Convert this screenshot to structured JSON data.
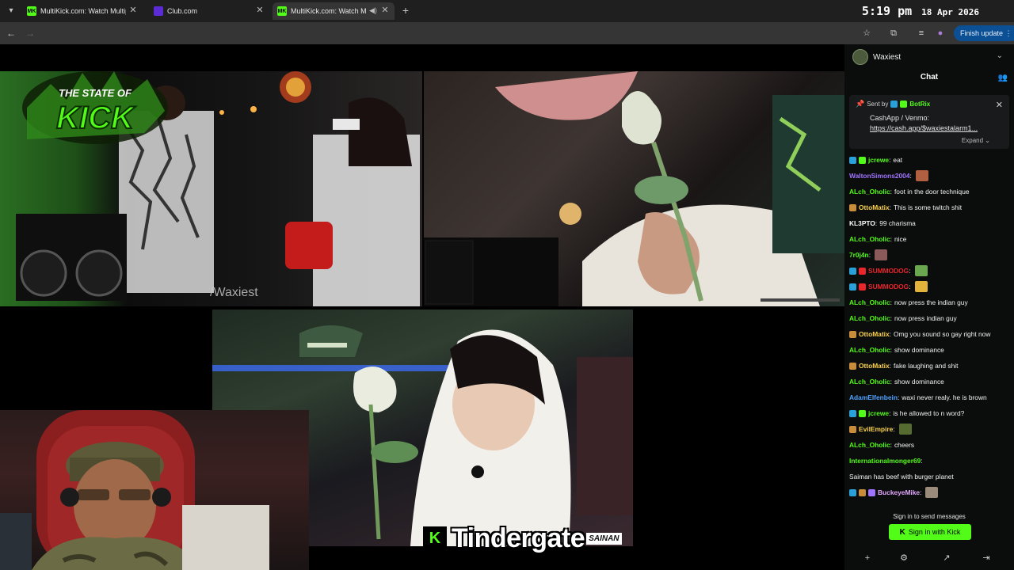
{
  "browser": {
    "tabs": [
      {
        "label": "MultiKick.com: Watch Multiple",
        "favicon": "MK",
        "favicon_color": "#53fc18",
        "active": false
      },
      {
        "label": "Club.com",
        "favicon": "",
        "favicon_color": "#5b2bd6",
        "active": false
      },
      {
        "label": "MultiKick.com: Watch Multi",
        "favicon": "MK",
        "favicon_color": "#53fc18",
        "active": true
      }
    ],
    "clock": {
      "time": "5:19 pm",
      "date": "18 Apr 2026"
    },
    "finish_update_label": "Finish update ⋮",
    "icons": [
      "tab-search-icon",
      "close-icon",
      "speaker-icon",
      "new-tab-icon",
      "back-icon",
      "forward-icon",
      "bookmark-star-icon",
      "extensions-icon",
      "reading-list-icon",
      "profile-icon"
    ]
  },
  "stream": {
    "logo": {
      "line1": "THE STATE OF",
      "line2": "KICK"
    },
    "watermark": "/Waxiest",
    "caption": {
      "text": "Tindergate",
      "tag": "SAINAN"
    }
  },
  "chat": {
    "channel": "Waxiest",
    "title": "Chat",
    "pinned": {
      "sent_by": "Sent by",
      "bot": "BotRix",
      "line1": "CashApp / Venmo:",
      "line2": "https://cash.app/$waxiestalarm1...",
      "expand": "Expand"
    },
    "messages": [
      {
        "user": "jcrewe",
        "color": "#53fc18",
        "text": "eat",
        "badges": [
          "#2aa0d8",
          "#53fc18"
        ],
        "emote": ""
      },
      {
        "user": "WaltonSimons2004",
        "color": "#a074ff",
        "text": "",
        "badges": [],
        "emote": "#b06040"
      },
      {
        "user": "ALch_Oholic",
        "color": "#53fc18",
        "text": "foot in the door technique",
        "badges": [],
        "emote": ""
      },
      {
        "user": "OttoMatix",
        "color": "#fcd34d",
        "text": "This is some twitch shit",
        "badges": [
          "#c98c3a"
        ],
        "emote": ""
      },
      {
        "user": "KL3PTO",
        "color": "#ffffff",
        "text": "99 charisma",
        "badges": [],
        "emote": ""
      },
      {
        "user": "ALch_Oholic",
        "color": "#53fc18",
        "text": "nice",
        "badges": [],
        "emote": ""
      },
      {
        "user": "7r0j4n",
        "color": "#53fc18",
        "text": "",
        "badges": [],
        "emote": "#8a5a5a"
      },
      {
        "user": "SUMMODOG",
        "color": "#e8262b",
        "text": "",
        "badges": [
          "#2aa0d8",
          "#e8262b"
        ],
        "emote": "#6aa84f"
      },
      {
        "user": "SUMMODOG",
        "color": "#e8262b",
        "text": "",
        "badges": [
          "#2aa0d8",
          "#e8262b"
        ],
        "emote": "#e1b33a"
      },
      {
        "user": "ALch_Oholic",
        "color": "#53fc18",
        "text": "now press the indian guy",
        "badges": [],
        "emote": ""
      },
      {
        "user": "ALch_Oholic",
        "color": "#53fc18",
        "text": "now press indian guy",
        "badges": [],
        "emote": ""
      },
      {
        "user": "OttoMatix",
        "color": "#fcd34d",
        "text": "Omg you sound so gay right now",
        "badges": [
          "#c98c3a"
        ],
        "emote": ""
      },
      {
        "user": "ALch_Oholic",
        "color": "#53fc18",
        "text": "show dominance",
        "badges": [],
        "emote": ""
      },
      {
        "user": "OttoMatix",
        "color": "#fcd34d",
        "text": "fake laughing and shit",
        "badges": [
          "#c98c3a"
        ],
        "emote": ""
      },
      {
        "user": "ALch_Oholic",
        "color": "#53fc18",
        "text": "show dominance",
        "badges": [],
        "emote": ""
      },
      {
        "user": "AdamElfenbein",
        "color": "#4fa3ff",
        "text": "waxi never realy. he is brown",
        "badges": [],
        "emote": ""
      },
      {
        "user": "jcrewe",
        "color": "#53fc18",
        "text": "is he allowed to n word?",
        "badges": [
          "#2aa0d8",
          "#53fc18"
        ],
        "emote": ""
      },
      {
        "user": "EvilEmpire",
        "color": "#fcd34d",
        "text": "",
        "badges": [
          "#c98c3a"
        ],
        "emote": "#556b2f"
      },
      {
        "user": "ALch_Oholic",
        "color": "#53fc18",
        "text": "cheers",
        "badges": [],
        "emote": ""
      },
      {
        "user": "Internationalmonger69",
        "color": "#53fc18",
        "text": "Saiman has beef with burger planet",
        "badges": [],
        "emote": ""
      },
      {
        "user": "BuckeyeMike",
        "color": "#e3a6ff",
        "text": "",
        "badges": [
          "#2aa0d8",
          "#c98c3a",
          "#a074ff"
        ],
        "emote": "#9a8a7a"
      }
    ],
    "footer": {
      "signin_text": "Sign in to send messages",
      "signin_button": "Sign in with Kick",
      "icons": [
        "add-user-icon",
        "settings-icon",
        "popout-icon",
        "exit-icon"
      ]
    }
  },
  "colors": {
    "kick_green": "#53fc18",
    "chat_bg": "#0b0c0c",
    "browser_bg": "#1f1f1f",
    "toolbar_bg": "#353535"
  }
}
